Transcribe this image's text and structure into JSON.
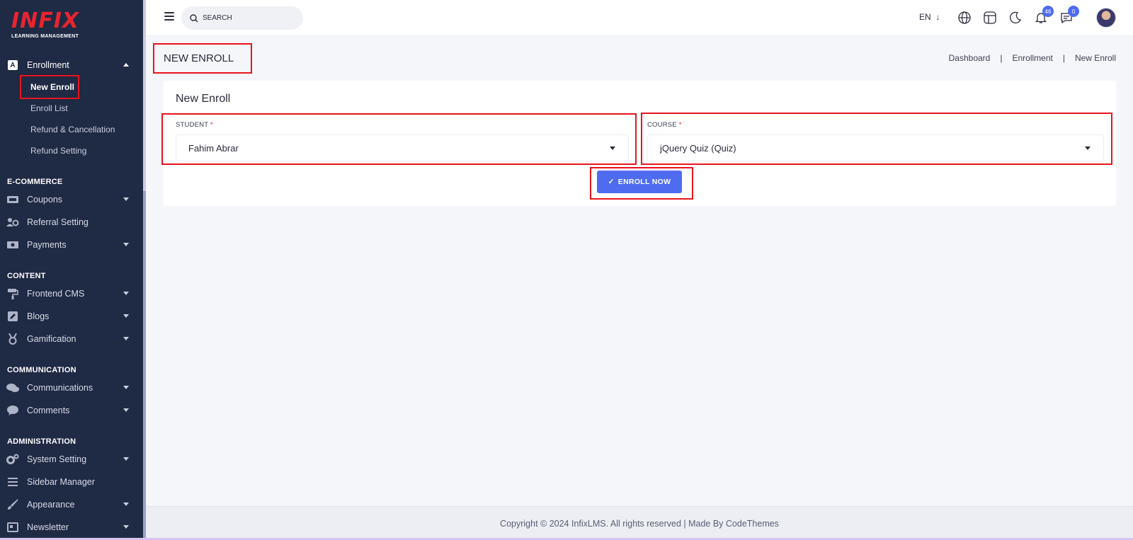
{
  "sidebar": {
    "logo_text": "INFIX",
    "logo_sub": "LEARNING MANAGEMENT",
    "enrollment": {
      "label": "Enrollment",
      "icon": "a-box-icon",
      "items": [
        {
          "label": "New Enroll"
        },
        {
          "label": "Enroll List"
        },
        {
          "label": "Refund & Cancellation"
        },
        {
          "label": "Refund Setting"
        }
      ]
    },
    "sections": {
      "ecommerce": "E-COMMERCE",
      "content": "CONTENT",
      "communication": "COMMUNICATION",
      "administration": "ADMINISTRATION"
    },
    "items": {
      "coupons": "Coupons",
      "referral": "Referral Setting",
      "payments": "Payments",
      "frontend_cms": "Frontend CMS",
      "blogs": "Blogs",
      "gamification": "Gamification",
      "communications": "Communications",
      "comments": "Comments",
      "system_setting": "System Setting",
      "sidebar_manager": "Sidebar Manager",
      "appearance": "Appearance",
      "newsletter": "Newsletter"
    }
  },
  "topbar": {
    "search_placeholder": "SEARCH",
    "language": "EN",
    "notifications_count": "46",
    "messages_count": "0",
    "icons": [
      "menu-icon",
      "search-icon",
      "globe-icon",
      "layout-icon",
      "moon-icon",
      "bell-icon",
      "chat-icon",
      "avatar"
    ]
  },
  "header": {
    "title": "NEW ENROLL",
    "breadcrumbs": [
      "Dashboard",
      "Enrollment",
      "New Enroll"
    ]
  },
  "form": {
    "title": "New Enroll",
    "student_label": "STUDENT",
    "student_value": "Fahim Abrar",
    "course_label": "COURSE",
    "course_value": "jQuery Quiz (Quiz)",
    "required_mark": "*",
    "submit_label": "ENROLL NOW"
  },
  "footer": {
    "text": "Copyright © 2024 InfixLMS. All rights reserved | Made By CodeThemes"
  },
  "colors": {
    "sidebar_bg": "#1f2a44",
    "accent": "#4f6bf0",
    "highlight": "#e8141d"
  }
}
